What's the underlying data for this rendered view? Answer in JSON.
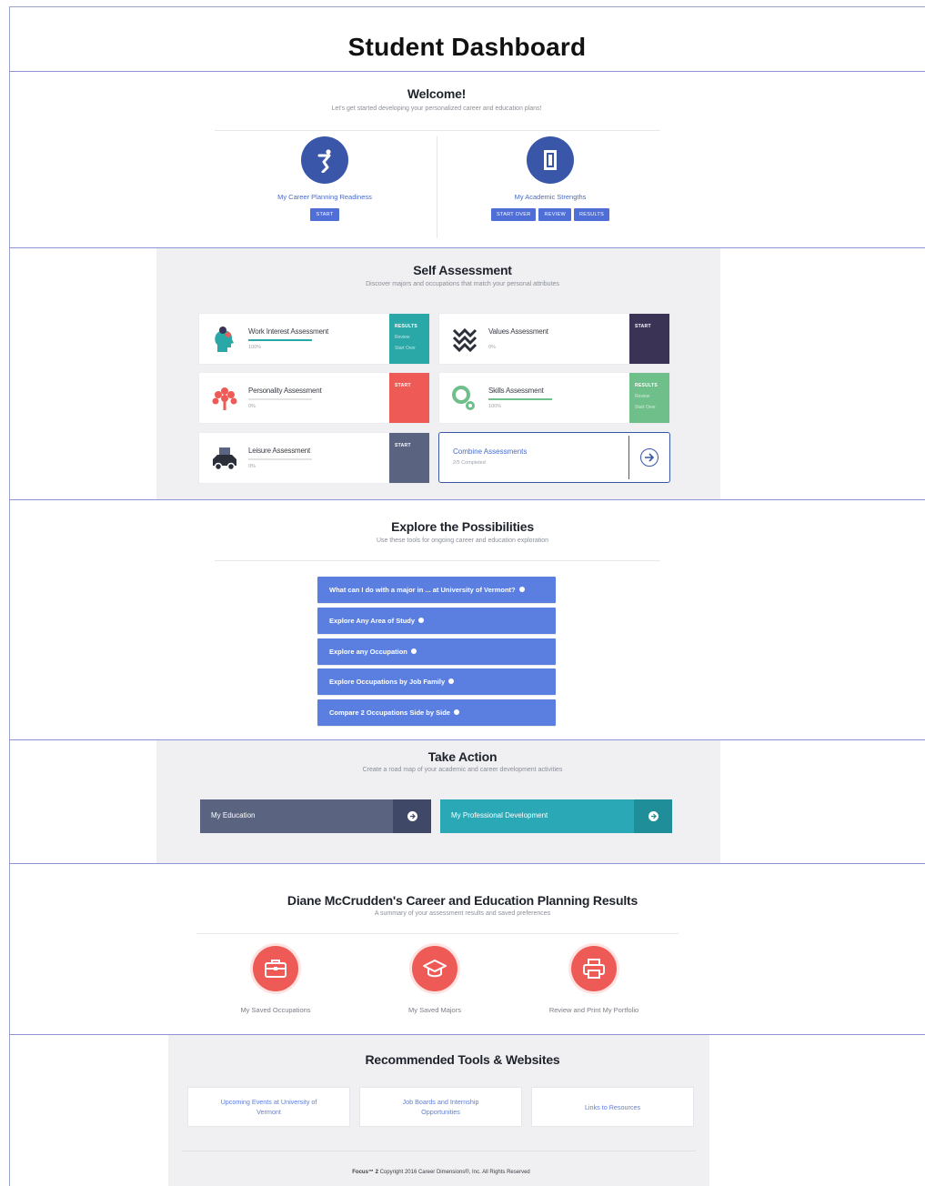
{
  "page_title": "Student Dashboard",
  "welcome": {
    "title": "Welcome!",
    "subtitle": "Let's get started developing your personalized career and education plans!",
    "cards": [
      {
        "label": "My Career Planning Readiness",
        "buttons": [
          "START"
        ],
        "icon": "runner-icon"
      },
      {
        "label": "My Academic Strengths",
        "buttons": [
          "START OVER",
          "REVIEW",
          "RESULTS"
        ],
        "icon": "book-icon"
      }
    ]
  },
  "self_assessment": {
    "title": "Self Assessment",
    "subtitle": "Discover majors and occupations that match your personal attributes",
    "items": [
      {
        "name": "Work Interest Assessment",
        "percent": "100%",
        "progress": 1.0,
        "side_title": "RESULTS",
        "side_links": [
          "Review",
          "Start Over"
        ],
        "side_color": "#2aa8a8",
        "icon": "head-gears-icon"
      },
      {
        "name": "Values Assessment",
        "percent": "0%",
        "progress": 0.0,
        "side_title": "START",
        "side_links": [],
        "side_color": "#3b3355",
        "icon": "zigzag-icon"
      },
      {
        "name": "Personality Assessment",
        "percent": "0%",
        "progress": 0.0,
        "side_title": "START",
        "side_links": [],
        "side_color": "#ee5a55",
        "icon": "tree-icon"
      },
      {
        "name": "Skills Assessment",
        "percent": "100%",
        "progress": 1.0,
        "side_title": "RESULTS",
        "side_links": [
          "Review",
          "Start Over"
        ],
        "side_color": "#6fbf8a",
        "icon": "skills-icon"
      },
      {
        "name": "Leisure Assessment",
        "percent": "0%",
        "progress": 0.0,
        "side_title": "START",
        "side_links": [],
        "side_color": "#5a6380",
        "icon": "car-icon"
      }
    ],
    "combine": {
      "name": "Combine Assessments",
      "sub": "2/5 Completed"
    }
  },
  "explore": {
    "title": "Explore the Possibilities",
    "subtitle": "Use these tools for ongoing career and education exploration",
    "buttons": [
      "What can I do with a major in ... at University of Vermont?",
      "Explore Any Area of Study",
      "Explore any Occupation",
      "Explore Occupations by Job Family",
      "Compare 2 Occupations Side by Side"
    ]
  },
  "take_action": {
    "title": "Take Action",
    "subtitle": "Create a road map of your academic and career development activities",
    "buttons": [
      {
        "label": "My Education",
        "color": "#5a6380",
        "arrow_bg": "#3f4866"
      },
      {
        "label": "My Professional Development",
        "color": "#2aa8b5",
        "arrow_bg": "#1f8e99"
      }
    ]
  },
  "results": {
    "title": "Diane McCrudden's Career and Education Planning Results",
    "subtitle": "A summary of your assessment results and saved preferences",
    "items": [
      {
        "label": "My Saved Occupations",
        "icon": "briefcase-icon"
      },
      {
        "label": "My Saved Majors",
        "icon": "graduation-cap-icon"
      },
      {
        "label": "Review and Print My Portfolio",
        "icon": "printer-icon"
      }
    ]
  },
  "tools": {
    "title": "Recommended Tools & Websites",
    "links": [
      "Upcoming Events at University of Vermont",
      "Job Boards and Internship Opportunities",
      "Links to Resources"
    ]
  },
  "footer": {
    "brand": "Focus™ 2",
    "text": "Copyright 2016 Career Dimensions®, Inc. All Rights Reserved"
  }
}
